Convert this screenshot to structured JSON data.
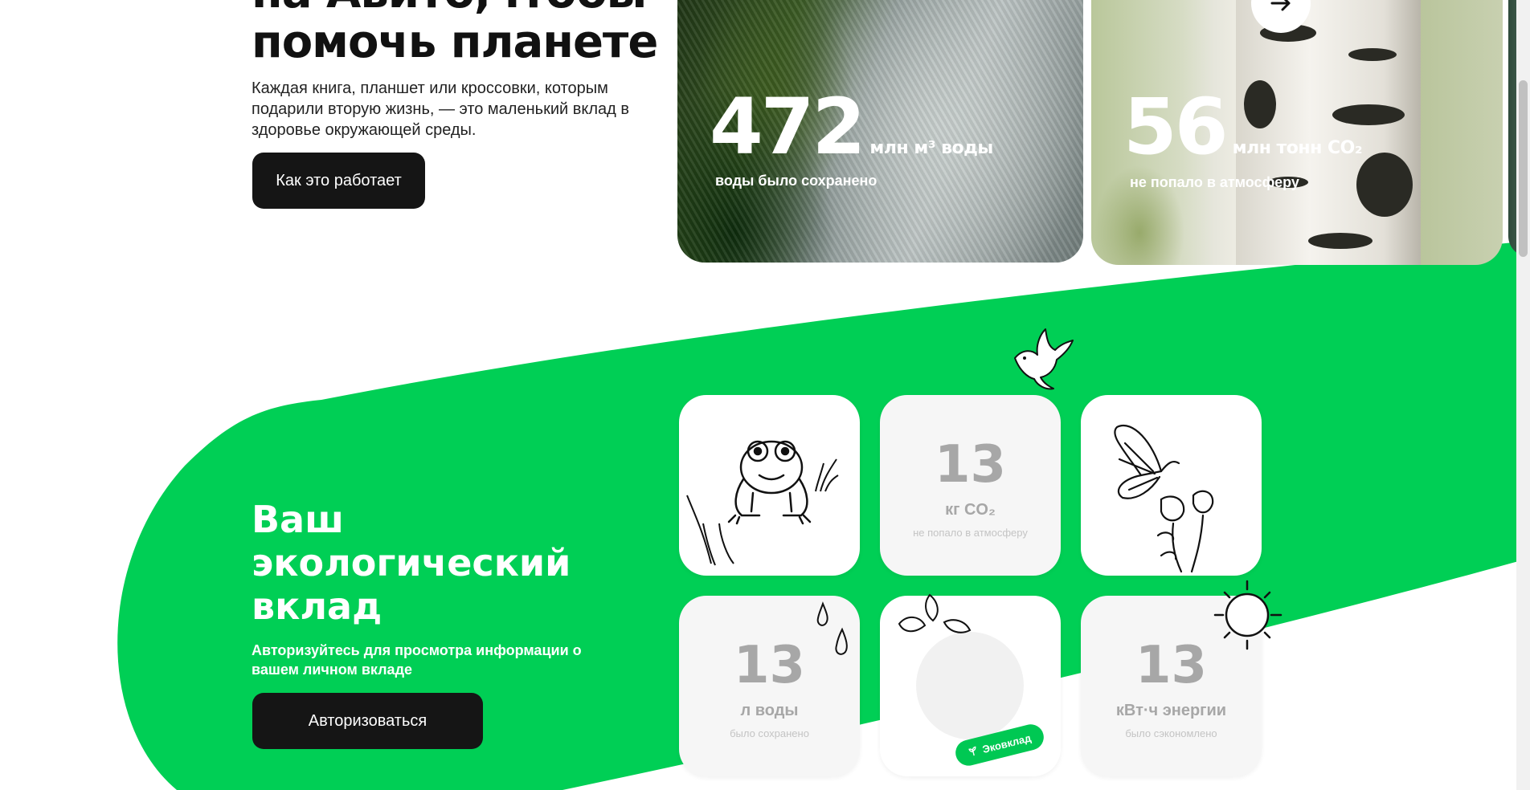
{
  "hero": {
    "title_line1": "на Авито,чтобы",
    "title_line2": "помочь планете",
    "description": "Каждая книга, планшет или кроссовки, которым подарили вторую жизнь, — это маленький вклад в здоровье окружающей среды.",
    "button_label": "Как это работает"
  },
  "stats": [
    {
      "value": "472",
      "unit": "млн м³ воды",
      "label": "воды было сохранено"
    },
    {
      "value": "56",
      "unit": "млн тонн CO₂",
      "label": "не попало в атмосферу"
    }
  ],
  "eco": {
    "title": "Ваш экологический вклад",
    "description": "Авторизуйтесь для просмотра информации о вашем личном вкладе",
    "button_label": "Авторизоваться",
    "badge_label": "Эковклад",
    "tiles": {
      "co2": {
        "value": "13",
        "unit": "кг CO₂",
        "caption": "не попало в атмосферу"
      },
      "water": {
        "value": "13",
        "unit": "л воды",
        "caption": "было сохранено"
      },
      "energy": {
        "value": "13",
        "unit": "кВт·ч энергии",
        "caption": "было сэкономлено"
      }
    }
  },
  "colors": {
    "accent_green": "#00cf55",
    "button_dark": "#151515",
    "tile_grey": "#a7a7a7"
  },
  "icons": [
    "arrow-right-icon",
    "dove-icon",
    "frog-icon",
    "grass-icon",
    "butterfly-icon",
    "flowers-icon",
    "raindrop-icon",
    "leaves-icon",
    "sun-icon",
    "sprout-icon"
  ]
}
